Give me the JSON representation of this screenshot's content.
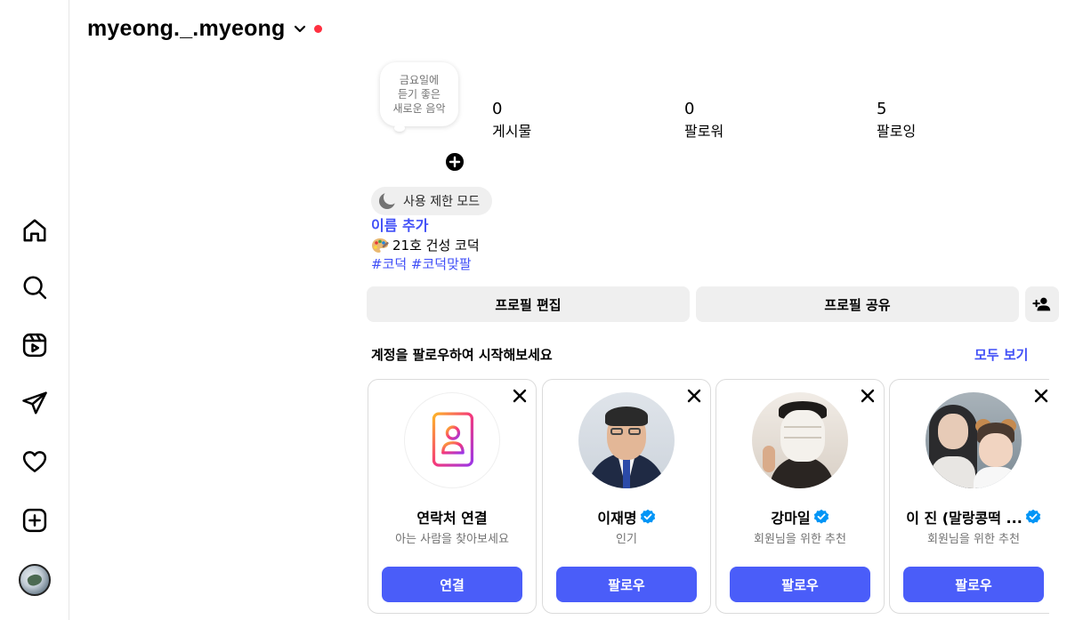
{
  "nav": {
    "items": [
      {
        "name": "home",
        "icon": "home-icon"
      },
      {
        "name": "search",
        "icon": "search-icon"
      },
      {
        "name": "reels",
        "icon": "reels-icon"
      },
      {
        "name": "messages",
        "icon": "send-icon"
      },
      {
        "name": "notifications",
        "icon": "heart-icon"
      },
      {
        "name": "create",
        "icon": "plus-square-icon"
      },
      {
        "name": "profile",
        "icon": "avatar"
      }
    ]
  },
  "profile": {
    "username": "myeong._.myeong",
    "note": "금요일에\n듣기 좋은\n새로운 음악",
    "stats": [
      {
        "value": "0",
        "label": "게시물"
      },
      {
        "value": "0",
        "label": "팔로워"
      },
      {
        "value": "5",
        "label": "팔로잉"
      }
    ],
    "restricted_mode": "사용 제한 모드",
    "add_name": "이름 추가",
    "bio": "21호 건성 코덕",
    "hashtags": "#코덕 #코덕맞팔",
    "edit_profile": "프로필 편집",
    "share_profile": "프로필 공유"
  },
  "suggestions": {
    "title": "계정을 팔로우하여 시작해보세요",
    "see_all": "모두 보기",
    "cards": [
      {
        "name": "연락처 연결",
        "subtitle": "아는 사람을 찾아보세요",
        "button": "연결",
        "verified": false
      },
      {
        "name": "이재명",
        "subtitle": "인기",
        "button": "팔로우",
        "verified": true
      },
      {
        "name": "강마일",
        "subtitle": "회원님을 위한 추천",
        "button": "팔로우",
        "verified": true
      },
      {
        "name": "이 진 (말랑콩떡 ...",
        "subtitle": "회원님을 위한 추천",
        "button": "팔로우",
        "verified": true
      }
    ]
  },
  "colors": {
    "accent": "#4a5df9",
    "link": "#4150f7",
    "notification_dot": "#ff3040",
    "verified": "#0095f6"
  }
}
